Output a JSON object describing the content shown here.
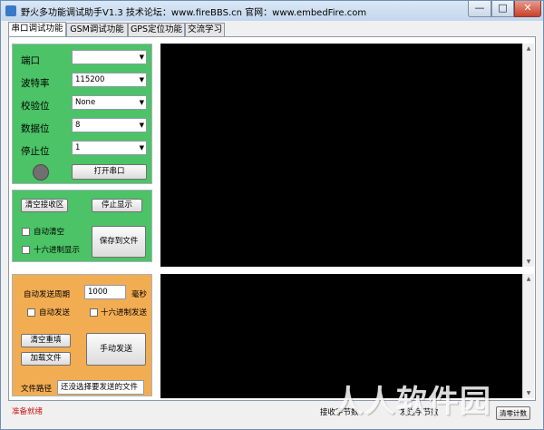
{
  "window": {
    "title": "野火多功能调试助手V1.3   技术论坛：www.fireBBS.cn   官网：www.embedFire.com",
    "min_glyph": "—",
    "max_glyph": "□",
    "close_glyph": "✕"
  },
  "tabs": [
    {
      "label": "串口调试功能",
      "active": true
    },
    {
      "label": "GSM调试功能",
      "active": false
    },
    {
      "label": "GPS定位功能",
      "active": false
    },
    {
      "label": "交流学习",
      "active": false
    }
  ],
  "serial": {
    "port_label": "端口",
    "port_value": "",
    "baud_label": "波特率",
    "baud_value": "115200",
    "parity_label": "校验位",
    "parity_value": "None",
    "databits_label": "数据位",
    "databits_value": "8",
    "stopbits_label": "停止位",
    "stopbits_value": "1",
    "open_button": "打开串口",
    "indicator_color": "#707070"
  },
  "receive": {
    "clear_button": "清空接收区",
    "stop_button": "停止显示",
    "auto_clear_label": "自动清空",
    "hex_display_label": "十六进制显示",
    "save_button": "保存到文件"
  },
  "send": {
    "period_label": "自动发送周期",
    "period_value": "1000",
    "period_unit": "毫秒",
    "auto_send_label": "自动发送",
    "hex_send_label": "十六进制发送",
    "clear_refill_button": "清空重填",
    "load_file_button": "加载文件",
    "manual_send_button": "手动发送",
    "file_path_label": "文件路径",
    "file_path_value": "还没选择要发送的文件"
  },
  "status": {
    "state": "准备就绪",
    "recv_bytes": "接收字节数",
    "send_bytes": "发送字节数",
    "reset_button": "清零计数"
  },
  "watermark": "人人软件园",
  "colors": {
    "serial_panel": "#4cc366",
    "send_panel": "#f2ad52",
    "screen": "#000000",
    "status_text": "#d01515"
  }
}
